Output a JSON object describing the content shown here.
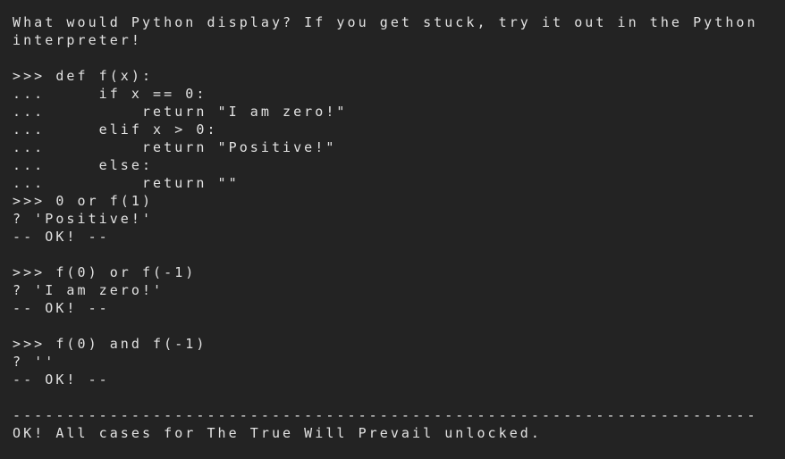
{
  "terminal": {
    "lines": [
      "What would Python display? If you get stuck, try it out in the Python",
      "interpreter!",
      "",
      ">>> def f(x):",
      "...     if x == 0:",
      "...         return \"I am zero!\"",
      "...     elif x > 0:",
      "...         return \"Positive!\"",
      "...     else:",
      "...         return \"\"",
      ">>> 0 or f(1)",
      "? 'Positive!'",
      "-- OK! --",
      "",
      ">>> f(0) or f(-1)",
      "? 'I am zero!'",
      "-- OK! --",
      "",
      ">>> f(0) and f(-1)",
      "? ''",
      "-- OK! --",
      "",
      "---------------------------------------------------------------------",
      "OK! All cases for The True Will Prevail unlocked."
    ]
  }
}
